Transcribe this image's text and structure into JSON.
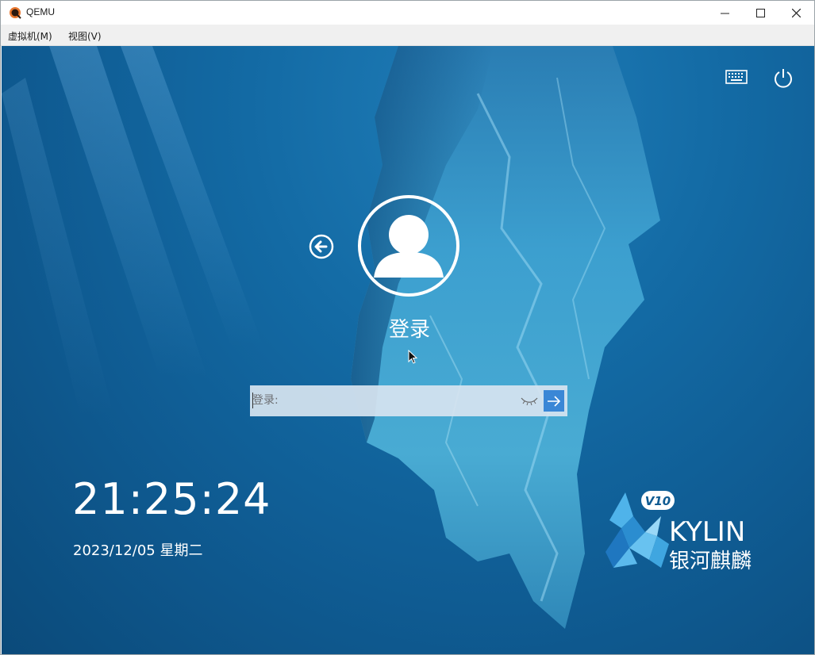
{
  "window": {
    "title": "QEMU",
    "controls": {
      "minimize": "minimize",
      "maximize": "maximize",
      "close": "close"
    }
  },
  "menu": {
    "items": [
      {
        "label": "虚拟机(M)"
      },
      {
        "label": "视图(V)"
      }
    ]
  },
  "login": {
    "username": "登录",
    "password_placeholder": "登录:",
    "icons": {
      "keyboard": "keyboard-icon",
      "power": "power-icon",
      "back": "back-arrow-icon",
      "avatar": "user-avatar-icon",
      "eye": "eye-closed-icon",
      "submit": "arrow-right-icon"
    }
  },
  "clock": {
    "time": "21:25:24",
    "date": "2023/12/05 星期二"
  },
  "branding": {
    "version": "V10",
    "name": "KYLIN",
    "name_cn": "银河麒麟"
  },
  "colors": {
    "accent": "#3a87d6",
    "background_top": "#1f7db8",
    "background_bottom": "#0b4a7a"
  }
}
